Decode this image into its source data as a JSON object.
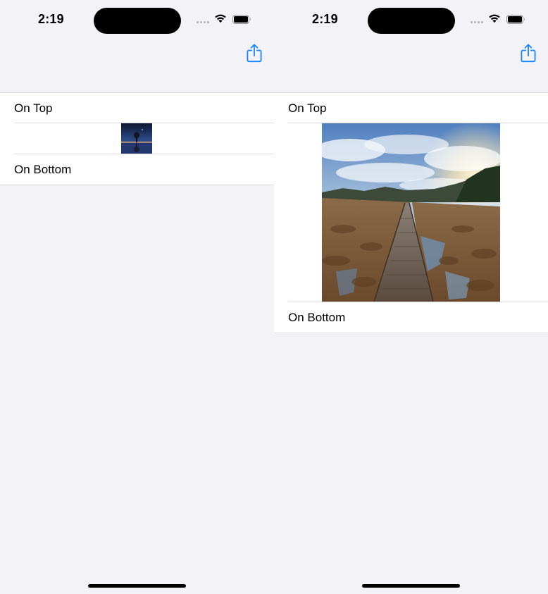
{
  "colors": {
    "background": "#f2f2f7",
    "accent": "#1a84ff",
    "separator": "#dcdce0"
  },
  "screens": [
    {
      "status": {
        "time": "2:19"
      },
      "toolbar": {
        "share_icon": "share-icon"
      },
      "list": {
        "top_label": "On Top",
        "image_name": "night-lake-tree-thumbnail",
        "bottom_label": "On Bottom"
      }
    },
    {
      "status": {
        "time": "2:19"
      },
      "toolbar": {
        "share_icon": "share-icon"
      },
      "list": {
        "top_label": "On Top",
        "image_name": "boardwalk-marsh-photo",
        "bottom_label": "On Bottom"
      }
    }
  ]
}
